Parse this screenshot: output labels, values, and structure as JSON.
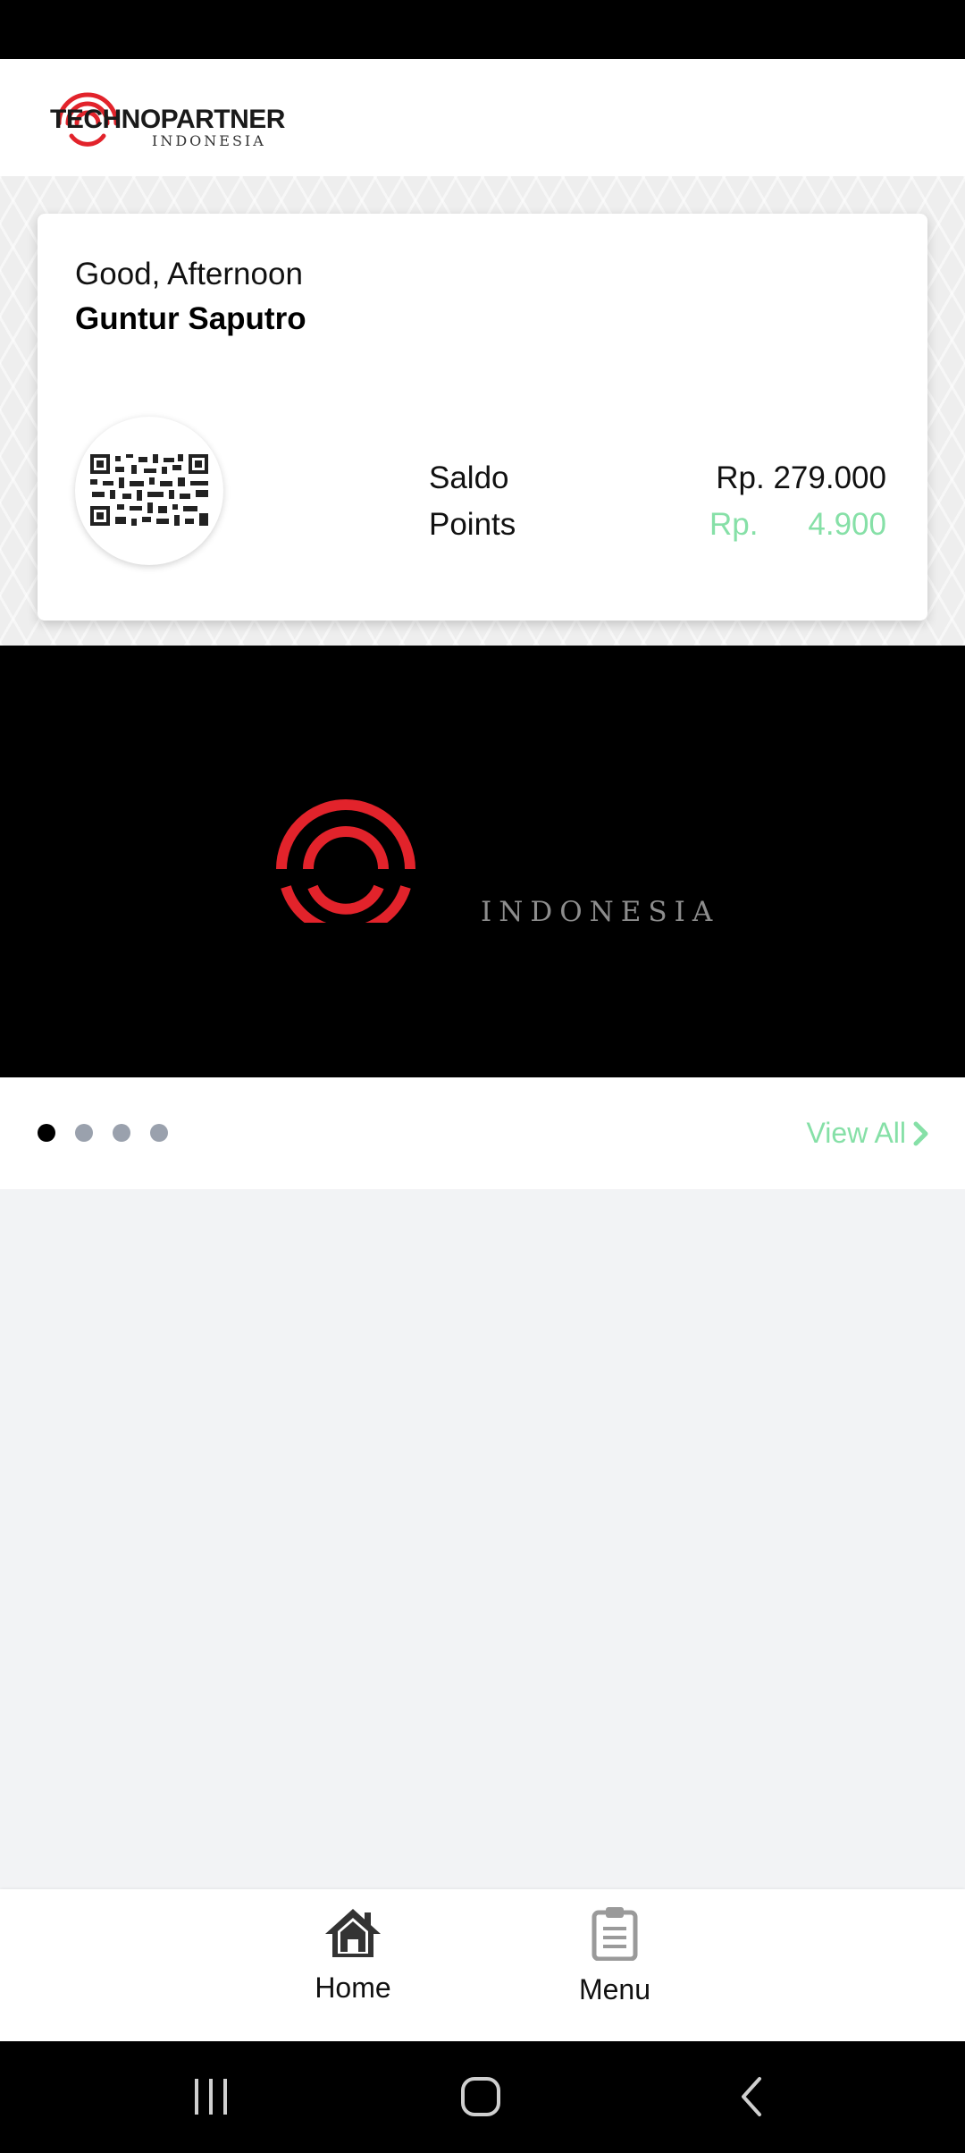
{
  "header": {
    "logo_name": "TECHNOPARTNER",
    "logo_sub": "INDONESIA"
  },
  "card": {
    "greeting": "Good, Afternoon",
    "user_name": "Guntur Saputro",
    "saldo_label": "Saldo",
    "saldo_value": "Rp. 279.000",
    "points_label": "Points",
    "points_currency": "Rp.",
    "points_value": "4.900"
  },
  "banner": {
    "text": "INDONESIA"
  },
  "carousel": {
    "dot_count": 4,
    "active_index": 0,
    "view_all_label": "View All"
  },
  "bottom_nav": {
    "items": [
      {
        "label": "Home",
        "icon": "home-icon"
      },
      {
        "label": "Menu",
        "icon": "clipboard-icon"
      }
    ]
  },
  "system_nav": {
    "icons": [
      "recent-apps-icon",
      "home-circle-icon",
      "back-icon"
    ]
  },
  "colors": {
    "accent_green": "#86e0a7",
    "brand_red": "#e2232b"
  }
}
